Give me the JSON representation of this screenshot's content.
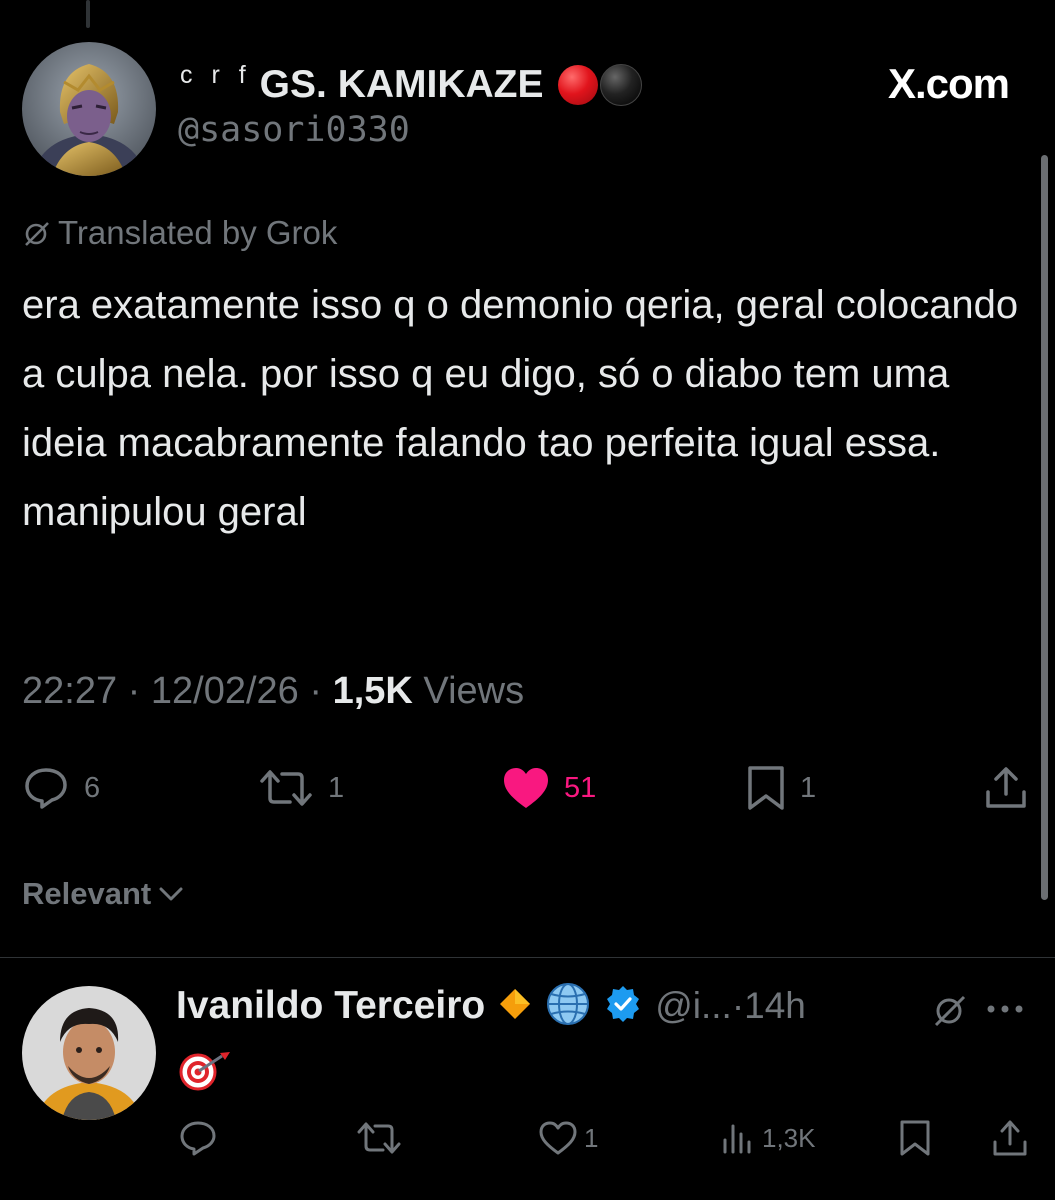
{
  "tweet": {
    "author": {
      "prefix": "c r f",
      "name": "GS. KAMIKAZE",
      "handle": "@sasori0330",
      "avatar": "thanos-avatar",
      "name_emoji": [
        "red-circle",
        "black-circle"
      ]
    },
    "brand": "X.com",
    "translated_label": "Translated by Grok",
    "text": "era exatamente isso q o demonio qeria, geral colocando a culpa nela. por isso q eu digo, só o diabo tem uma ideia macabramente falando tao perfeita igual essa. manipulou geral",
    "time": "22:27 · 12/02/26 · ",
    "views_count": "1,5K",
    "views_label": "Views",
    "actions": {
      "replies": "6",
      "retweets": "1",
      "likes": "51",
      "bookmarks": "1"
    },
    "like_color": "#f91880"
  },
  "sort": {
    "label": "Relevant"
  },
  "reply": {
    "name": "Ivanildo Terceiro",
    "badges": [
      "orange-diamond-icon",
      "globe-icon",
      "verified-badge-icon"
    ],
    "handle": "@i...",
    "time": "·14h",
    "emoji": "🎯",
    "actions": {
      "likes": "1",
      "views": "1,3K"
    }
  },
  "colors": {
    "background": "#000000",
    "text": "#e7e9ea",
    "muted": "#71767b",
    "verified": "#1d9bf0"
  }
}
